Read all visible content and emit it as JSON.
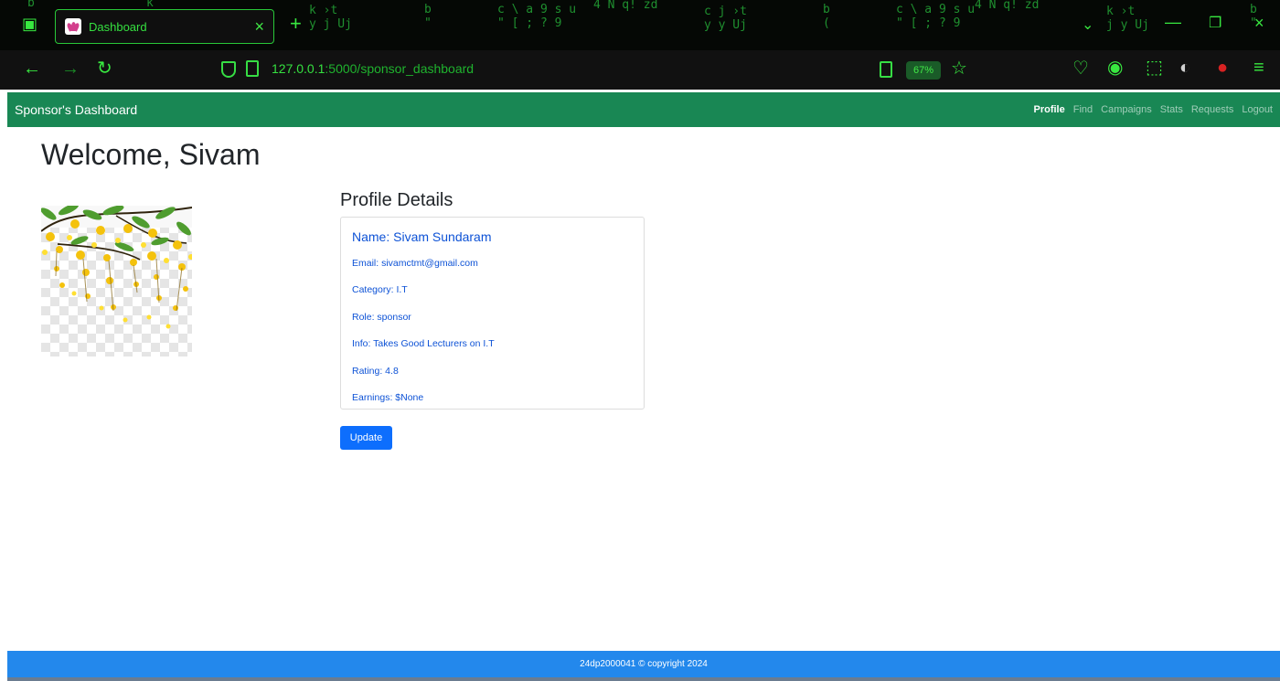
{
  "browser": {
    "tab": {
      "title": "Dashboard"
    },
    "address": {
      "host": "127.0.0.1",
      "path": ":5000/sponsor_dashboard"
    },
    "zoom": "67%"
  },
  "app": {
    "brand": "Sponsor's Dashboard",
    "nav": {
      "profile": "Profile",
      "find": "Find",
      "campaigns": "Campaigns",
      "stats": "Stats",
      "requests": "Requests",
      "logout": "Logout"
    }
  },
  "page": {
    "welcome": "Welcome, Sivam",
    "profile_title": "Profile Details",
    "profile": {
      "name": "Name: Sivam Sundaram",
      "email": "Email: sivamctmt@gmail.com",
      "category": "Category: I.T",
      "role": "Role: sponsor",
      "info": "Info: Takes Good Lecturers on I.T",
      "rating": "Rating: 4.8",
      "earnings": "Earnings: $None"
    },
    "update_label": "Update"
  },
  "footer": {
    "copyright": "24dp2000041 © copyright 2024"
  },
  "theme": {
    "chrome_green": "#35e040",
    "app_nav": "#198754",
    "primary": "#0d6efd",
    "footer": "#2388ec"
  },
  "icons": [
    "tab-list-icon",
    "favicon-lotus-icon",
    "tab-close-icon",
    "new-tab-icon",
    "back-icon",
    "forward-icon",
    "reload-icon",
    "shield-icon",
    "page-icon",
    "reader-icon",
    "bookmark-star-icon",
    "pocket-icon",
    "account-icon",
    "extensions-icon",
    "ghost-extension-icon",
    "block-extension-icon",
    "menu-icon",
    "minimize-icon",
    "restore-icon",
    "window-close-icon"
  ]
}
